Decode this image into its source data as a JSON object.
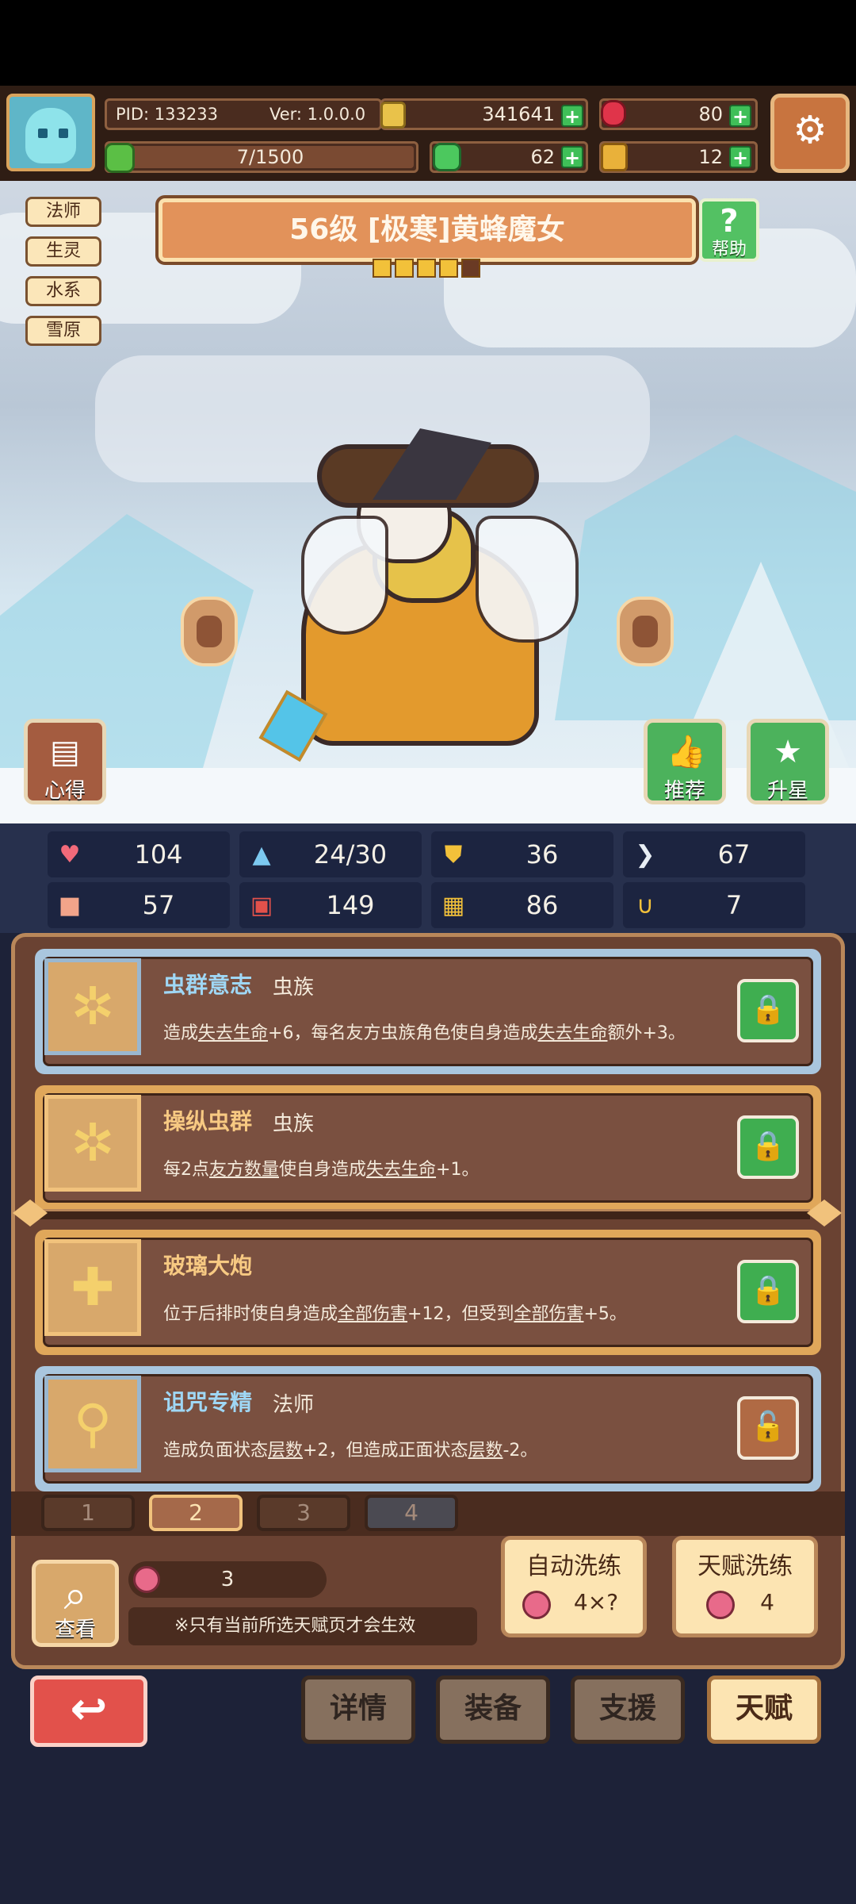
{
  "header": {
    "pid": "PID: 133233",
    "version": "Ver: 1.0.0.0",
    "gold": "341641",
    "gems": "80",
    "exp": "7/1500",
    "clover": "62",
    "boot": "12"
  },
  "hero": {
    "tags": [
      "法师",
      "生灵",
      "水系",
      "雪原"
    ],
    "title": "56级 [极寒]黄蜂魔女",
    "help_label": "帮助",
    "stars_filled": 4,
    "stars_total": 5,
    "left_button": "心得",
    "recommend_button": "推荐",
    "upstar_button": "升星"
  },
  "stats": {
    "hp": "104",
    "mana": "24/30",
    "armor": "36",
    "speed": "67",
    "attack": "57",
    "magic": "149",
    "skill": "86",
    "luck": "7"
  },
  "talents": [
    {
      "name": "虫群意志",
      "sub": "虫族",
      "desc_parts": [
        "造成",
        "失去生命",
        "+6，每名友方虫族角色使自身造成",
        "失去生命",
        "额外+3。"
      ]
    },
    {
      "name": "操纵虫群",
      "sub": "虫族",
      "desc_parts": [
        "每2点",
        "友方数量",
        "使自身造成",
        "失去生命",
        "+1。"
      ]
    },
    {
      "name": "玻璃大炮",
      "sub": "",
      "desc_parts": [
        "位于后排时使自身造成",
        "全部伤害",
        "+12，但受到",
        "全部伤害",
        "+5。"
      ]
    },
    {
      "name": "诅咒专精",
      "sub": "法师",
      "desc_parts": [
        "造成负面状态",
        "层数",
        "+2，但造成正面状态",
        "层数",
        "-2。"
      ]
    }
  ],
  "pages": [
    "1",
    "2",
    "3",
    "4"
  ],
  "selected_page": "2",
  "bottom": {
    "view_label": "查看",
    "fruit_count": "3",
    "notice": "※只有当前所选天赋页才会生效",
    "auto_wash_label": "自动洗练",
    "auto_wash_cost": "4×?",
    "talent_wash_label": "天赋洗练",
    "talent_wash_cost": "4"
  },
  "nav": {
    "details": "详情",
    "equipment": "装备",
    "support": "支援",
    "talent": "天赋"
  },
  "colors": {
    "accent_orange": "#e2925a",
    "panel_brown": "#6a4232",
    "green_button": "#3fae50",
    "back_red": "#e2514b"
  }
}
